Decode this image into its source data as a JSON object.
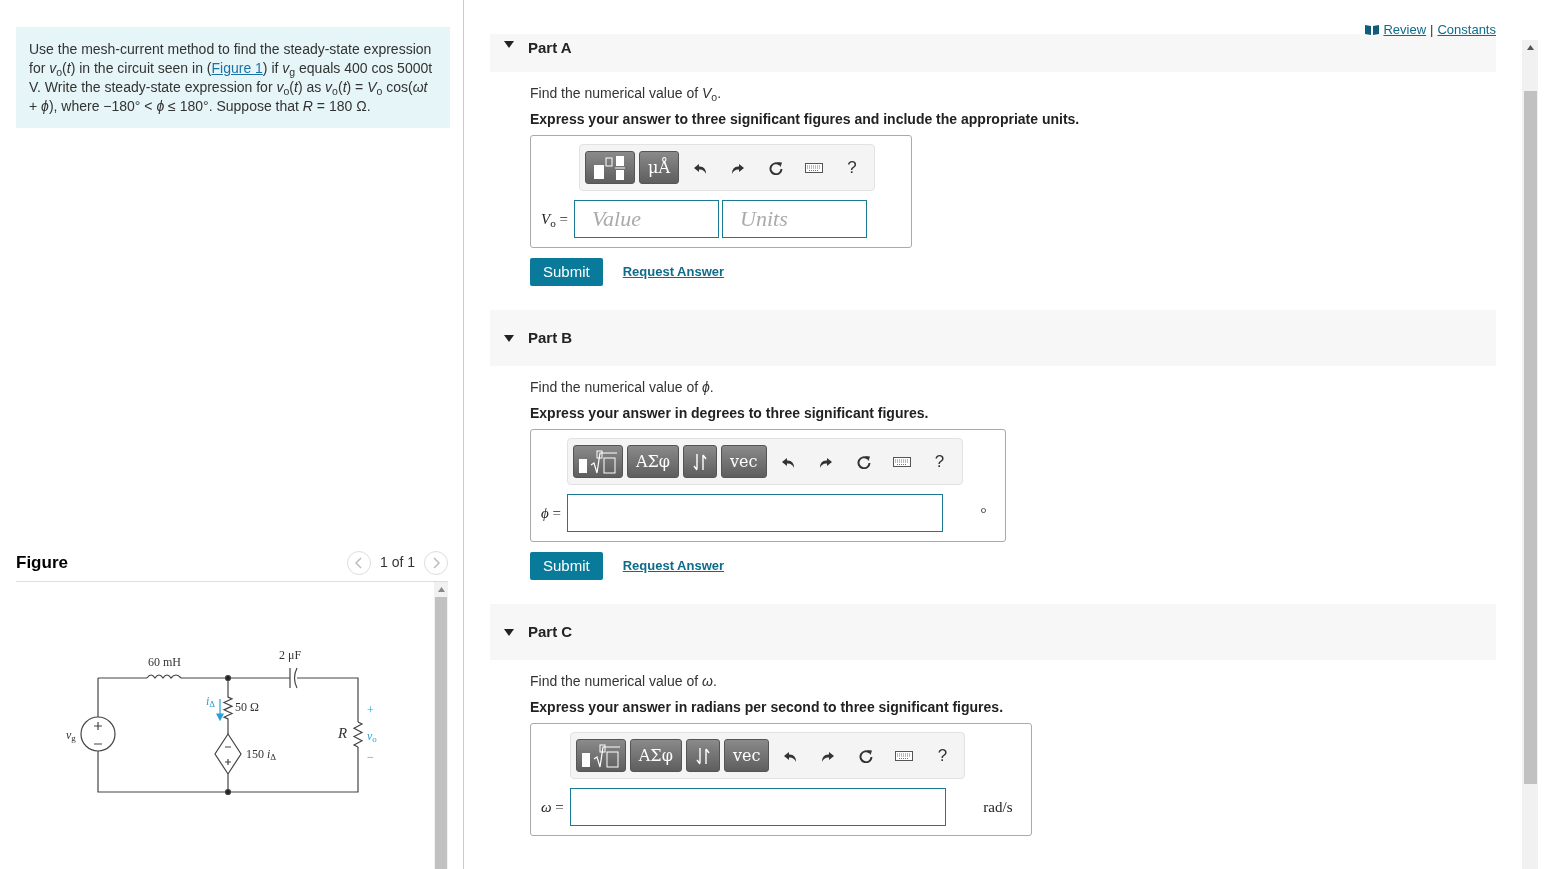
{
  "problem": {
    "before": "Use the mesh-current method to find the steady-state expression for *v*$_{o}$(*t*) in the circuit seen in (",
    "link": "Figure 1",
    "after": ") if *v*$_{g}$ equals 400 cos 5000t V. Write the steady-state expression for *v*$_{o}$(*t*) as *v*$_{o}$(*t*) = *V*$_{o}$ cos(*ωt* + *ϕ*), where −180° < *ϕ* ≤ 180°. Suppose that *R* = 180 Ω."
  },
  "figure": {
    "title": "Figure",
    "pager": "1 of 1",
    "circuit": {
      "inductor": "60 mH",
      "capacitor": "2 μF",
      "resistor": "50 Ω",
      "dependent_source": "150 *i*$_{Δ}$",
      "current": "*i*$_{Δ}$",
      "source": "*v*$_{g}$",
      "load": "R",
      "output": "*v*$_{o}$",
      "output_plus": "+",
      "output_minus": "−"
    }
  },
  "header_separator": "|",
  "header_links": [
    {
      "kind": "review",
      "label": "Review"
    },
    {
      "kind": "constants",
      "label": "Constants"
    }
  ],
  "parts": [
    {
      "title": "Part A",
      "expanded": true,
      "prompt": "Find the numerical value of *V*$_{o}$.",
      "instruction": "Express your answer to three significant figures and include the appropriate units.",
      "label": "*V*$_{o}$ =",
      "toolbar": [
        {
          "kind": "template_units"
        },
        {
          "kind": "symbol",
          "label": "μÅ"
        },
        {
          "kind": "undo"
        },
        {
          "kind": "redo"
        },
        {
          "kind": "reset"
        },
        {
          "kind": "keyboard"
        },
        {
          "kind": "help",
          "label": "?"
        }
      ],
      "fields": [
        {
          "kind": "value",
          "placeholder": "Value"
        },
        {
          "kind": "units",
          "placeholder": "Units"
        }
      ],
      "buttons": [
        {
          "kind": "submit",
          "label": "Submit"
        },
        {
          "kind": "request",
          "label": "Request Answer"
        }
      ]
    },
    {
      "title": "Part B",
      "expanded": true,
      "prompt": "Find the numerical value of *ϕ*.",
      "instruction": "Express your answer in degrees to three significant figures.",
      "label": "*ϕ* =",
      "toolbar": [
        {
          "kind": "template_math"
        },
        {
          "kind": "symbol",
          "label": "ΑΣφ"
        },
        {
          "kind": "arrows"
        },
        {
          "kind": "symbol",
          "label": "vec"
        },
        {
          "kind": "undo"
        },
        {
          "kind": "redo"
        },
        {
          "kind": "reset"
        },
        {
          "kind": "keyboard"
        },
        {
          "kind": "help",
          "label": "?"
        }
      ],
      "fields": [
        {
          "kind": "plain"
        }
      ],
      "unit": "°",
      "buttons": [
        {
          "kind": "submit",
          "label": "Submit"
        },
        {
          "kind": "request",
          "label": "Request Answer"
        }
      ]
    },
    {
      "title": "Part C",
      "expanded": true,
      "prompt": "Find the numerical value of *ω*.",
      "instruction": "Express your answer in radians per second to three significant figures.",
      "label": "*ω* =",
      "toolbar": [
        {
          "kind": "template_math"
        },
        {
          "kind": "symbol",
          "label": "ΑΣφ"
        },
        {
          "kind": "arrows"
        },
        {
          "kind": "symbol",
          "label": "vec"
        },
        {
          "kind": "undo"
        },
        {
          "kind": "redo"
        },
        {
          "kind": "reset"
        },
        {
          "kind": "keyboard"
        },
        {
          "kind": "help",
          "label": "?"
        }
      ],
      "fields": [
        {
          "kind": "plain"
        }
      ],
      "unit": "rad/s"
    }
  ]
}
